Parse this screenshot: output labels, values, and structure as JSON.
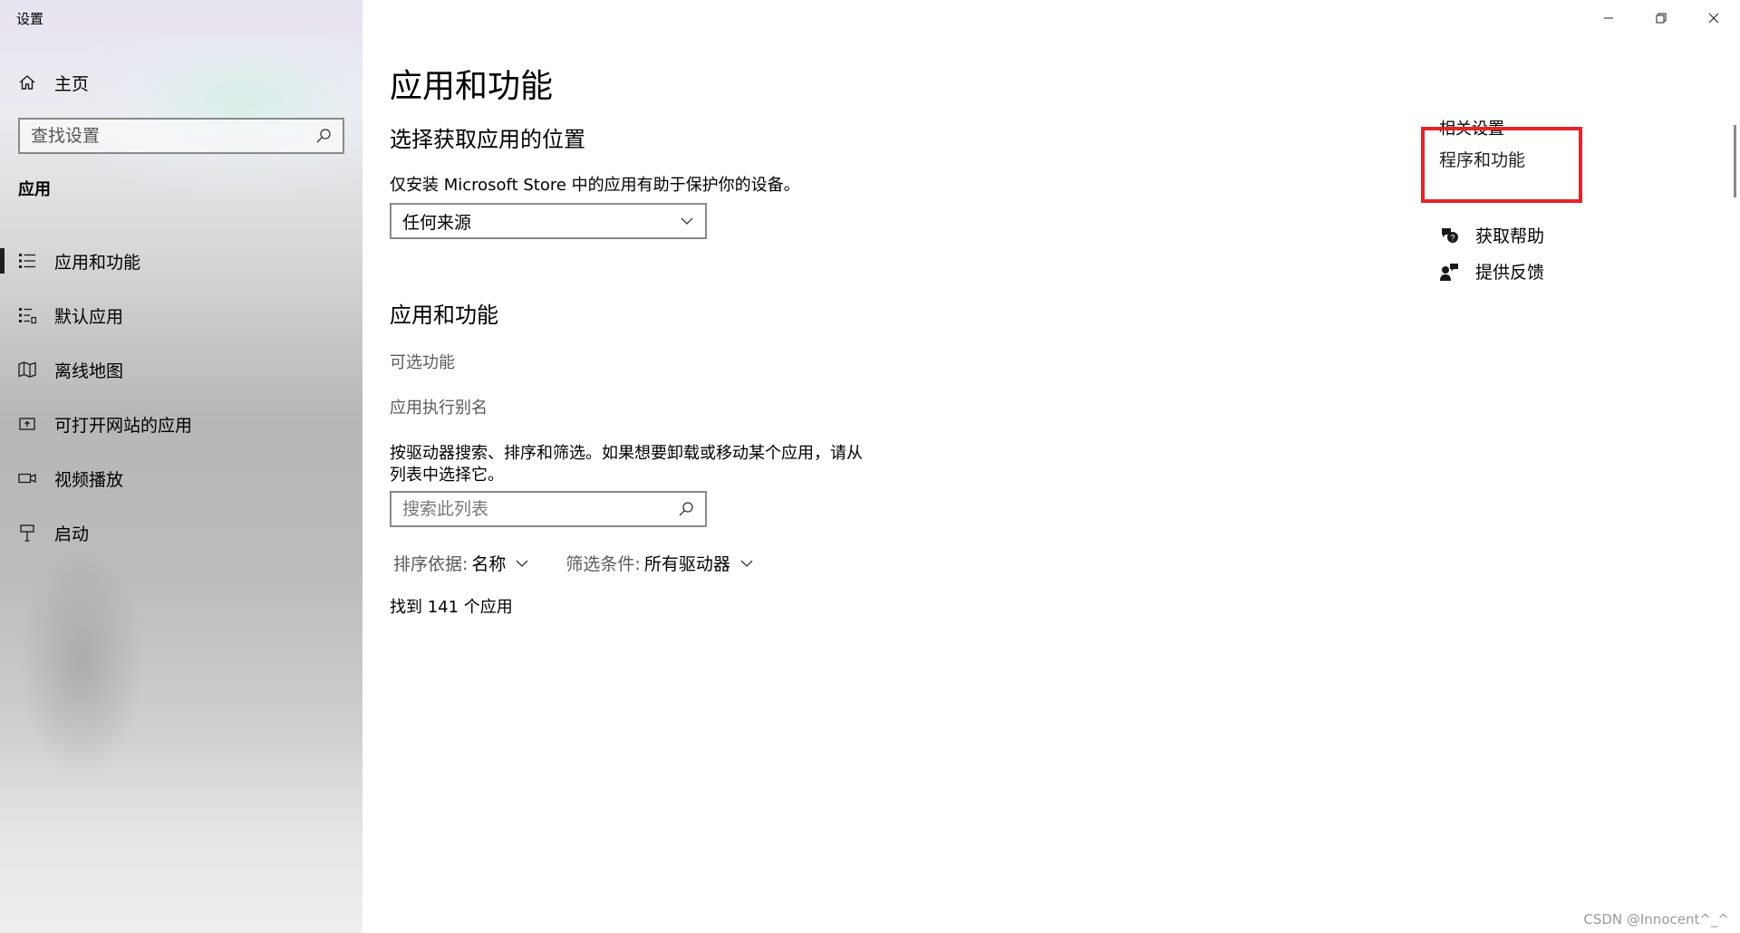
{
  "window": {
    "title": "设置",
    "controls": {
      "minimize": "minimize-icon",
      "restore": "restore-icon",
      "close": "close-icon"
    }
  },
  "sidebar": {
    "home_label": "主页",
    "search_placeholder": "查找设置",
    "section": "应用",
    "items": [
      {
        "label": "应用和功能",
        "icon": "list-icon",
        "active": true
      },
      {
        "label": "默认应用",
        "icon": "default-apps-icon",
        "active": false
      },
      {
        "label": "离线地图",
        "icon": "map-icon",
        "active": false
      },
      {
        "label": "可打开网站的应用",
        "icon": "open-website-icon",
        "active": false
      },
      {
        "label": "视频播放",
        "icon": "video-icon",
        "active": false
      },
      {
        "label": "启动",
        "icon": "startup-icon",
        "active": false
      }
    ]
  },
  "main": {
    "title": "应用和功能",
    "source_heading": "选择获取应用的位置",
    "source_desc": "仅安装 Microsoft Store 中的应用有助于保护你的设备。",
    "source_dropdown_value": "任何来源",
    "apps_heading": "应用和功能",
    "optional_features": "可选功能",
    "exec_alias": "应用执行别名",
    "search_desc_line1": "按驱动器搜索、排序和筛选。如果想要卸载或移动某个应用，请从",
    "search_desc_line2": "列表中选择它。",
    "list_search_placeholder": "搜索此列表",
    "sort_key": "排序依据:",
    "sort_value": "名称",
    "filter_key": "筛选条件:",
    "filter_value": "所有驱动器",
    "found_text": "找到 141 个应用"
  },
  "related": {
    "title": "相关设置",
    "link": "程序和功能",
    "highlight_color": "#e6232a"
  },
  "help": {
    "get_help": "获取帮助",
    "feedback": "提供反馈"
  },
  "watermark": "CSDN @Innocent^_^"
}
